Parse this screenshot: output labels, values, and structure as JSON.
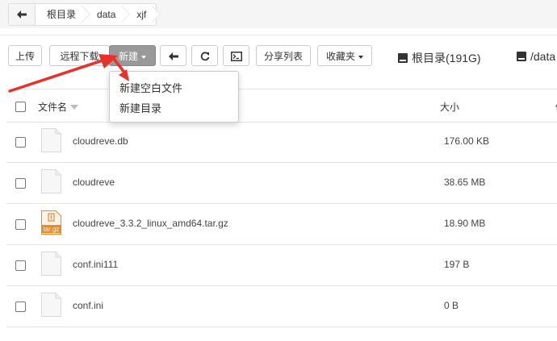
{
  "breadcrumb": {
    "back_icon": "arrow-left-icon",
    "items": [
      "根目录",
      "data",
      "xjf"
    ]
  },
  "toolbar": {
    "upload": "上传",
    "remote_download": "远程下载",
    "new": "新建",
    "share_list": "分享列表",
    "favorites": "收藏夹",
    "back_icon": "arrow-left-icon",
    "refresh_icon": "refresh-icon",
    "terminal_icon": "terminal-icon"
  },
  "drives": [
    {
      "label": "根目录(191G)",
      "icon": "drive-icon"
    },
    {
      "label": "/data",
      "icon": "drive-icon"
    }
  ],
  "table": {
    "col_name": "文件名",
    "col_size": "大小",
    "col_more": "修"
  },
  "files": [
    {
      "name": "cloudreve.db",
      "size": "176.00 KB",
      "icon": "file-icon"
    },
    {
      "name": "cloudreve",
      "size": "38.65 MB",
      "icon": "file-icon"
    },
    {
      "name": "cloudreve_3.3.2_linux_amd64.tar.gz",
      "size": "18.90 MB",
      "icon": "archive-icon",
      "badge": "tar.gz"
    },
    {
      "name": "conf.ini111",
      "size": "197 B",
      "icon": "file-icon"
    },
    {
      "name": "conf.ini",
      "size": "0 B",
      "icon": "file-icon"
    }
  ],
  "new_menu": {
    "items": [
      "新建空白文件",
      "新建目录"
    ]
  },
  "colors": {
    "annotation_arrow": "#e8312a",
    "archive_icon": "#e8892b"
  }
}
